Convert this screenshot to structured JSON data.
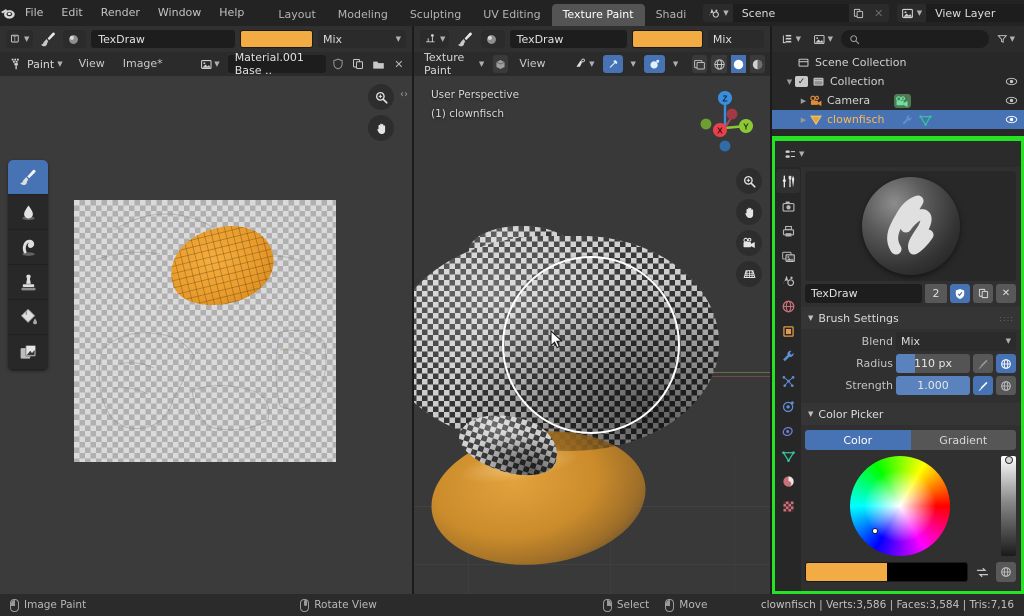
{
  "app": {
    "name": "Blender",
    "logo_icon": "blender-logo"
  },
  "topbar": {
    "menus": [
      "File",
      "Edit",
      "Render",
      "Window",
      "Help"
    ],
    "workspace_tabs": [
      {
        "label": "Layout",
        "active": false
      },
      {
        "label": "Modeling",
        "active": false
      },
      {
        "label": "Sculpting",
        "active": false
      },
      {
        "label": "UV Editing",
        "active": false
      },
      {
        "label": "Texture Paint",
        "active": true
      },
      {
        "label": "Shadi",
        "active": false
      }
    ],
    "scene": {
      "icon": "scene-icon",
      "value": "Scene",
      "new_icon": "copy-icon",
      "close_icon": "x-icon"
    },
    "view_layer": {
      "icon": "view-layer-icon",
      "value": "View Layer",
      "new_icon": "copy-icon",
      "close_icon": "x-icon"
    }
  },
  "brush_toolbar_left": {
    "tool_icon": "brush-tool-dropdown-icon",
    "brush_icon": "paintbrush-icon",
    "texture_icon": "brush-texture-icon",
    "brush_name": "TexDraw",
    "color": "#f2ac43",
    "blend_mode": "Mix"
  },
  "brush_toolbar_right": {
    "tool_icon": "paint-mode-dropdown-icon",
    "brush_icon": "paintbrush-icon",
    "texture_icon": "brush-texture-icon",
    "brush_name": "TexDraw",
    "color": "#f2ac43",
    "blend_mode": "Mix"
  },
  "image_editor": {
    "mode": "Paint",
    "menus": [
      "View",
      "Image*"
    ],
    "image_name": "Material.001 Base ..",
    "fake_user_icon": "shield-icon",
    "new_image_icon": "copy-icon",
    "open_image_icon": "folder-icon",
    "unlink_icon": "x-icon",
    "zoom_icon": "zoom-icon",
    "pan_icon": "hand-icon",
    "sidebar_toggle_icon": "chevron-left-right-icon"
  },
  "viewport": {
    "mode": "Texture Paint",
    "menus": [
      "View"
    ],
    "perspective_label": "User Perspective",
    "object_label": "(1) clownfisch",
    "gizmo_axes": [
      {
        "label": "X",
        "color": "#e8414b"
      },
      {
        "label": "Y",
        "color": "#8dc735"
      },
      {
        "label": "Z",
        "color": "#3b8ede"
      }
    ],
    "nav_buttons": [
      "zoom-icon",
      "hand-icon",
      "camera-icon",
      "grid-icon"
    ],
    "header_toggles": [
      "visibility-icon",
      "snap-magnet-icon",
      "proportional-edit-icon",
      "xray-icon"
    ],
    "shading_modes": [
      "wireframe-icon",
      "solid-icon",
      "material-preview-icon"
    ]
  },
  "toolbar_tools": [
    {
      "name": "draw",
      "icon": "paintbrush-icon",
      "active": true
    },
    {
      "name": "soften",
      "icon": "droplet-icon",
      "active": false
    },
    {
      "name": "smear",
      "icon": "smear-icon",
      "active": false
    },
    {
      "name": "clone",
      "icon": "stamp-icon",
      "active": false
    },
    {
      "name": "fill",
      "icon": "paint-bucket-icon",
      "active": false
    },
    {
      "name": "mask",
      "icon": "mask-icon",
      "active": false
    }
  ],
  "outliner": {
    "display_mode_icon": "outliner-icon",
    "filter_id_icon": "id-type-icon",
    "search_placeholder": "",
    "filter_icon": "funnel-icon",
    "rows": [
      {
        "label": "Scene Collection",
        "icon": "collection-icon",
        "indent": 0,
        "selected": false,
        "eye": false,
        "checkbox": false,
        "disclosure": ""
      },
      {
        "label": "Collection",
        "icon": "collection-icon",
        "indent": 1,
        "selected": false,
        "eye": true,
        "checkbox": true,
        "disclosure": "▼"
      },
      {
        "label": "Camera",
        "icon": "camera-object-icon",
        "indent": 2,
        "selected": false,
        "eye": true,
        "checkbox": false,
        "disclosure": "▶"
      },
      {
        "label": "clownfisch",
        "icon": "mesh-object-icon",
        "indent": 2,
        "selected": true,
        "eye": true,
        "checkbox": false,
        "disclosure": "▶"
      }
    ]
  },
  "properties": {
    "editor_type_icon": "properties-editor-icon",
    "tabs": [
      {
        "name": "tool",
        "icon": "tool-icon",
        "active": true
      },
      {
        "name": "render",
        "icon": "render-camera-icon",
        "active": false
      },
      {
        "name": "output",
        "icon": "printer-icon",
        "active": false
      },
      {
        "name": "view-layer",
        "icon": "images-icon",
        "active": false
      },
      {
        "name": "scene",
        "icon": "scene-cone-icon",
        "active": false
      },
      {
        "name": "world",
        "icon": "world-globe-icon",
        "active": false
      },
      {
        "name": "object",
        "icon": "object-square-icon",
        "active": false
      },
      {
        "name": "modifiers",
        "icon": "wrench-icon",
        "active": false
      },
      {
        "name": "particles",
        "icon": "particles-icon",
        "active": false
      },
      {
        "name": "physics",
        "icon": "physics-orbit-icon",
        "active": false
      },
      {
        "name": "constraints",
        "icon": "constraint-icon",
        "active": false
      },
      {
        "name": "data",
        "icon": "mesh-data-triangle-icon",
        "active": false
      },
      {
        "name": "material",
        "icon": "material-sphere-icon",
        "active": false
      },
      {
        "name": "texture",
        "icon": "texture-checker-icon",
        "active": false
      }
    ],
    "brush": {
      "preview_icon": "brush-preview-sphere",
      "name": "TexDraw",
      "users": "2",
      "fake_user_icon": "shield-check-icon",
      "duplicate_icon": "copy-icon",
      "unlink_icon": "x-icon",
      "browse_icon": "browse-brush-icon",
      "collapse_icon": "chevron-down-icon"
    },
    "brush_settings": {
      "title": "Brush Settings",
      "blend_label": "Blend",
      "blend_value": "Mix",
      "radius_label": "Radius",
      "radius_value": "110 px",
      "radius_fill_pct": 25,
      "strength_label": "Strength",
      "strength_value": "1.000",
      "strength_fill_pct": 100,
      "pressure_icon": "pressure-pen-icon",
      "unified_icon": "unified-globe-icon"
    },
    "color_picker": {
      "title": "Color Picker",
      "tabs": [
        {
          "label": "Color",
          "active": true
        },
        {
          "label": "Gradient",
          "active": false
        }
      ],
      "primary_color": "#f2ac43",
      "secondary_color": "#000000",
      "swap_icon": "swap-arrows-icon",
      "unified_icon": "unified-globe-icon",
      "value_slider_pct": 2
    }
  },
  "statusbar": {
    "hints": [
      {
        "mouse": "left",
        "label": "Image Paint"
      },
      {
        "mouse": "middle",
        "label": "Rotate View"
      },
      {
        "mouse": "right",
        "label": "Select"
      },
      {
        "mouse": "left2",
        "label": "Move"
      }
    ],
    "stats": "clownfisch | Verts:3,586 | Faces:3,584 | Tris:7,16"
  }
}
